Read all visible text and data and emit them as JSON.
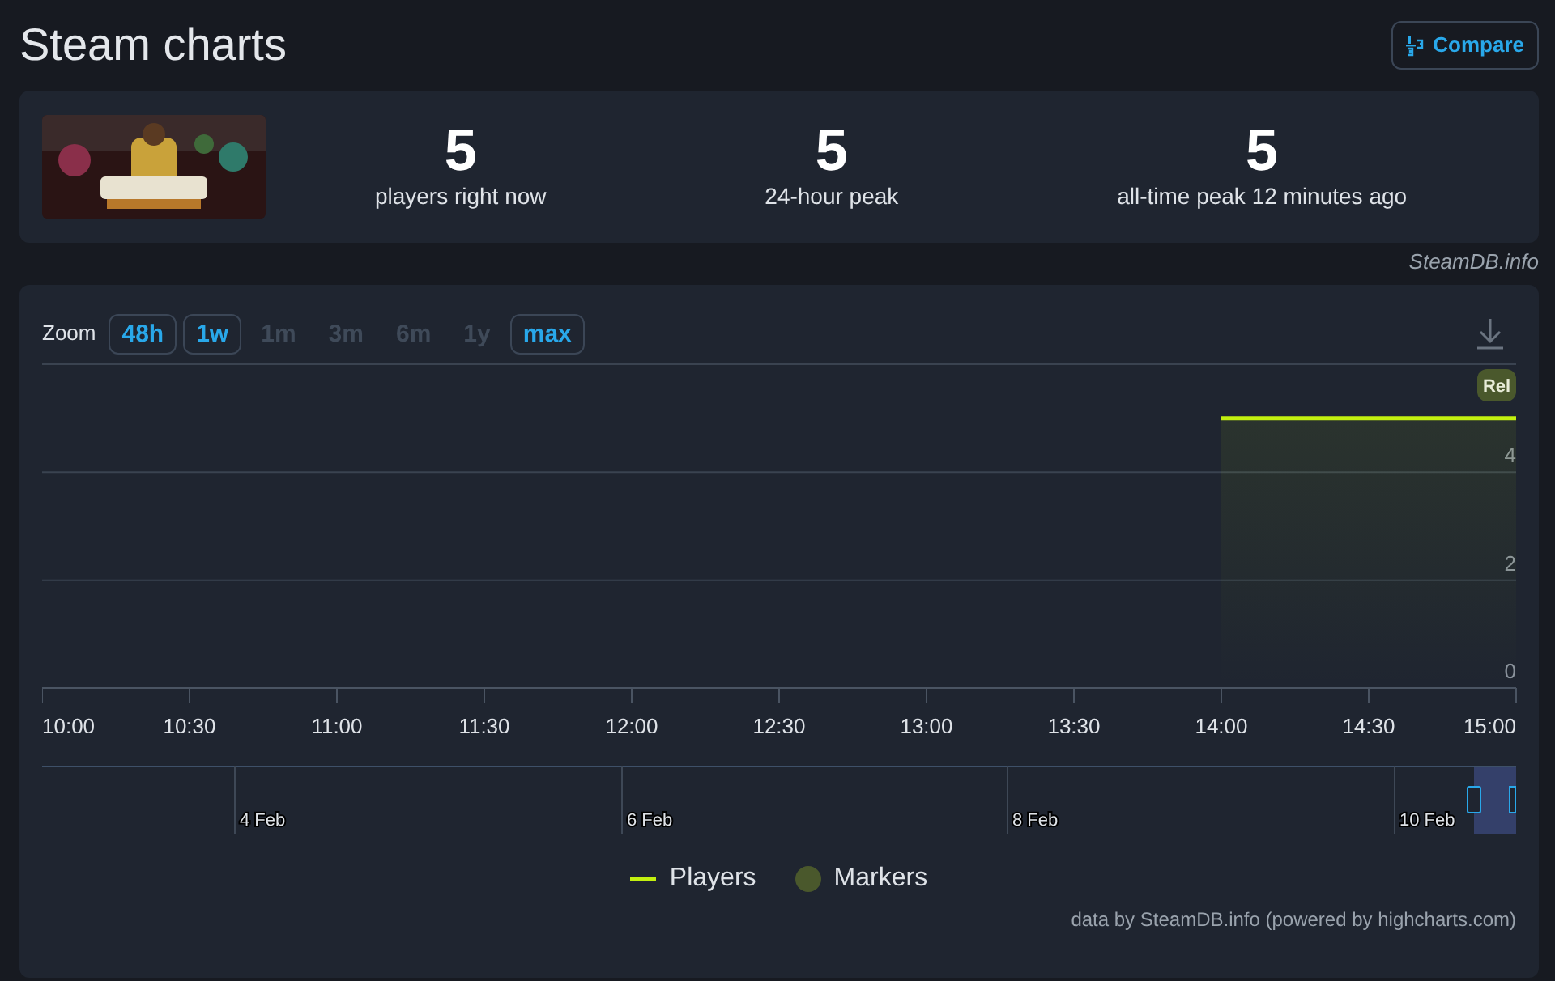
{
  "header": {
    "title": "Steam charts",
    "compare_button": "Compare"
  },
  "summary": {
    "stats": [
      {
        "value": "5",
        "label": "players right now"
      },
      {
        "value": "5",
        "label": "24-hour peak"
      },
      {
        "value": "5",
        "label": "all-time peak 12 minutes ago"
      }
    ]
  },
  "source_note": "SteamDB.info",
  "chart_panel": {
    "zoom_label": "Zoom",
    "zoom_buttons": [
      {
        "label": "48h",
        "disabled": false
      },
      {
        "label": "1w",
        "disabled": false
      },
      {
        "label": "1m",
        "disabled": true
      },
      {
        "label": "3m",
        "disabled": true
      },
      {
        "label": "6m",
        "disabled": true
      },
      {
        "label": "1y",
        "disabled": true
      },
      {
        "label": "max",
        "disabled": false
      }
    ],
    "chart_data": {
      "type": "area",
      "x": [
        "10:00",
        "10:30",
        "11:00",
        "11:30",
        "12:00",
        "12:30",
        "13:00",
        "13:30",
        "14:00",
        "14:30",
        "15:00"
      ],
      "ylim": [
        0,
        6
      ],
      "yticks": [
        0,
        2,
        4
      ],
      "series": [
        {
          "name": "Players",
          "color": "#c3f00f",
          "values": [
            null,
            null,
            null,
            null,
            null,
            null,
            null,
            null,
            5,
            5,
            5
          ]
        }
      ],
      "annotations": [
        "Rel"
      ]
    },
    "navigator": {
      "labels": [
        "4 Feb",
        "6 Feb",
        "8 Feb",
        "10 Feb"
      ]
    },
    "legend": [
      {
        "label": "Markers",
        "kind": "dot",
        "color": "#4a582c"
      }
    ],
    "credits": "data by SteamDB.info (powered by highcharts.com)"
  }
}
